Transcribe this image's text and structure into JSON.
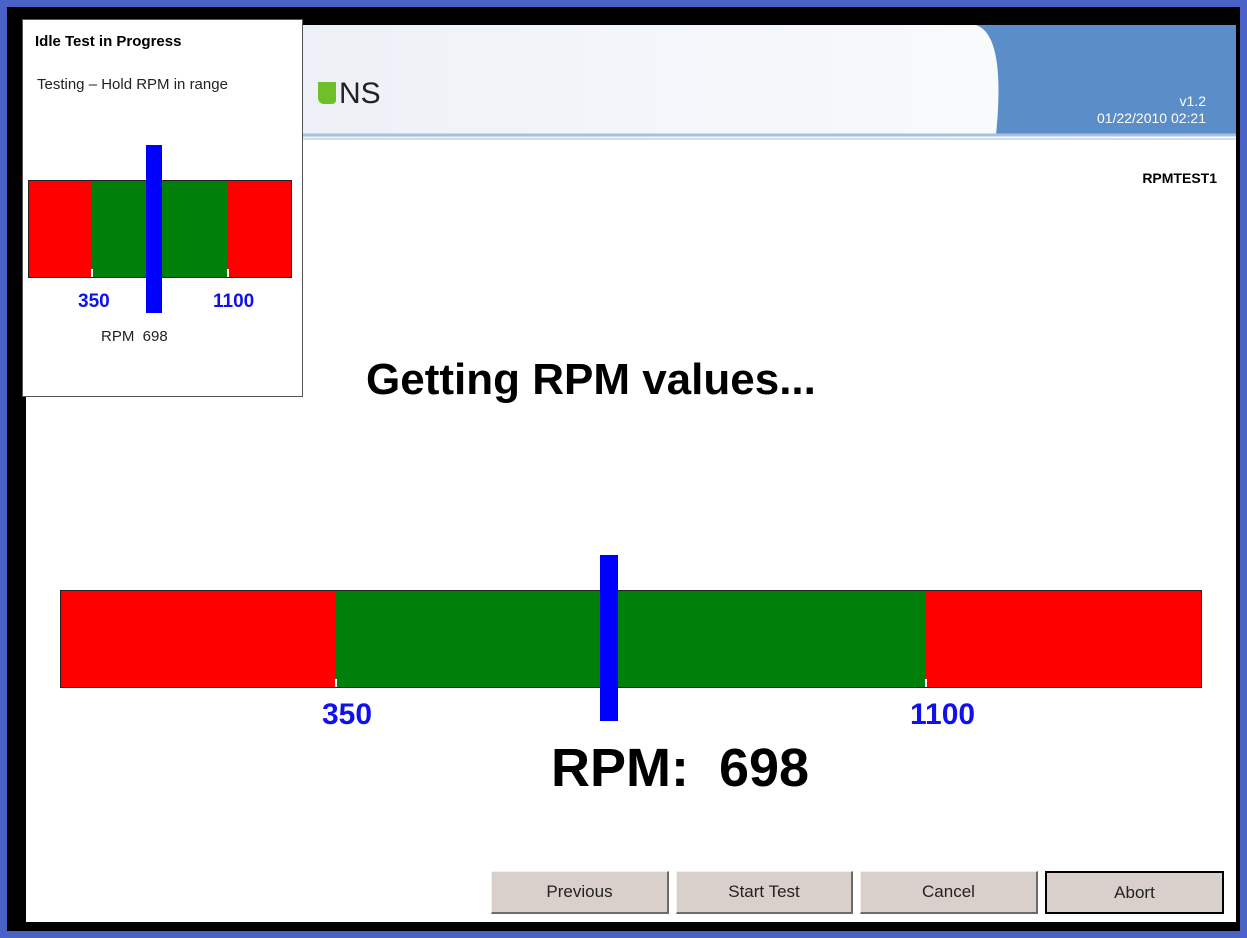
{
  "header": {
    "logo_text": "NS",
    "version": "v1.2",
    "datetime": "01/22/2010 02:21",
    "accent_color": "#5b8ec8"
  },
  "screen_id": "RPMTEST1",
  "status_message": "Getting RPM values...",
  "gauge": {
    "min_label": "350",
    "max_label": "1100",
    "rpm_text": "RPM:  698",
    "rpm_value": 698,
    "range_low": 350,
    "range_high": 1100,
    "scale_min": 0,
    "scale_max": 1450,
    "colors": {
      "in_range": "#00800a",
      "out_of_range": "#ff0000",
      "needle": "#0000ff",
      "labels": "#1111ee"
    }
  },
  "popup": {
    "title": "Idle Test in Progress",
    "message": "Testing – Hold RPM in range",
    "min_label": "350",
    "max_label": "1100",
    "rpm_text": "RPM  698"
  },
  "buttons": {
    "previous": "Previous",
    "start_test": "Start Test",
    "cancel": "Cancel",
    "abort": "Abort"
  }
}
